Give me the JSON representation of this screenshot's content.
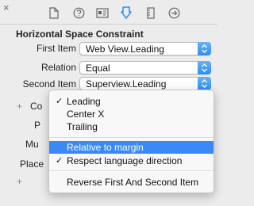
{
  "tabs": [
    {
      "name": "file-inspector-icon"
    },
    {
      "name": "help-inspector-icon"
    },
    {
      "name": "identity-inspector-icon"
    },
    {
      "name": "attributes-inspector-icon"
    },
    {
      "name": "size-inspector-icon"
    },
    {
      "name": "connections-inspector-icon"
    }
  ],
  "colors": {
    "accent": "#3b88f7",
    "panel": "#ececec"
  },
  "section": {
    "title": "Horizontal Space Constraint"
  },
  "first_item": {
    "label": "First Item",
    "value": "Web View.Leading"
  },
  "relation": {
    "label": "Relation",
    "value": "Equal"
  },
  "second_item": {
    "label": "Second Item",
    "value": "Superview.Leading"
  },
  "hidden_rows": {
    "constant_partial": "Co",
    "priority_partial": "P",
    "multiplier_partial": "Mu",
    "placeholder_partial": "Place"
  },
  "menu": {
    "items": [
      {
        "label": "Leading",
        "checked": "✓"
      },
      {
        "label": "Center X",
        "checked": ""
      },
      {
        "label": "Trailing",
        "checked": ""
      },
      {
        "label": "Relative to margin",
        "checked": ""
      },
      {
        "label": "Respect language direction",
        "checked": "✓"
      },
      {
        "label": "Reverse First And Second Item",
        "checked": ""
      }
    ]
  }
}
